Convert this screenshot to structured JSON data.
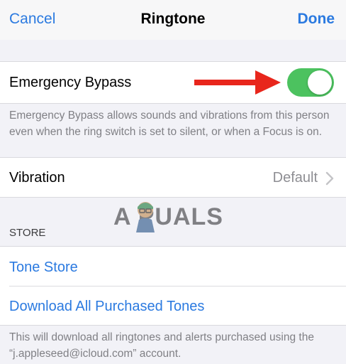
{
  "nav": {
    "cancel_label": "Cancel",
    "title": "Ringtone",
    "done_label": "Done"
  },
  "emergency": {
    "label": "Emergency Bypass",
    "toggle_on": true,
    "footer": "Emergency Bypass allows sounds and vibrations from this person even when the ring switch is set to silent, or when a Focus is on."
  },
  "vibration": {
    "label": "Vibration",
    "value": "Default"
  },
  "store": {
    "header": "STORE",
    "items": [
      {
        "label": "Tone Store"
      },
      {
        "label": "Download All Purchased Tones"
      }
    ],
    "footer": "This will download all ringtones and alerts purchased using the “j.appleseed@icloud.com” account."
  },
  "watermark": {
    "text": "A  PUALS"
  },
  "colors": {
    "accent": "#2b7ae0",
    "toggle_on": "#4cc25f",
    "arrow": "#e8261c",
    "background": "#f2f2f7"
  }
}
